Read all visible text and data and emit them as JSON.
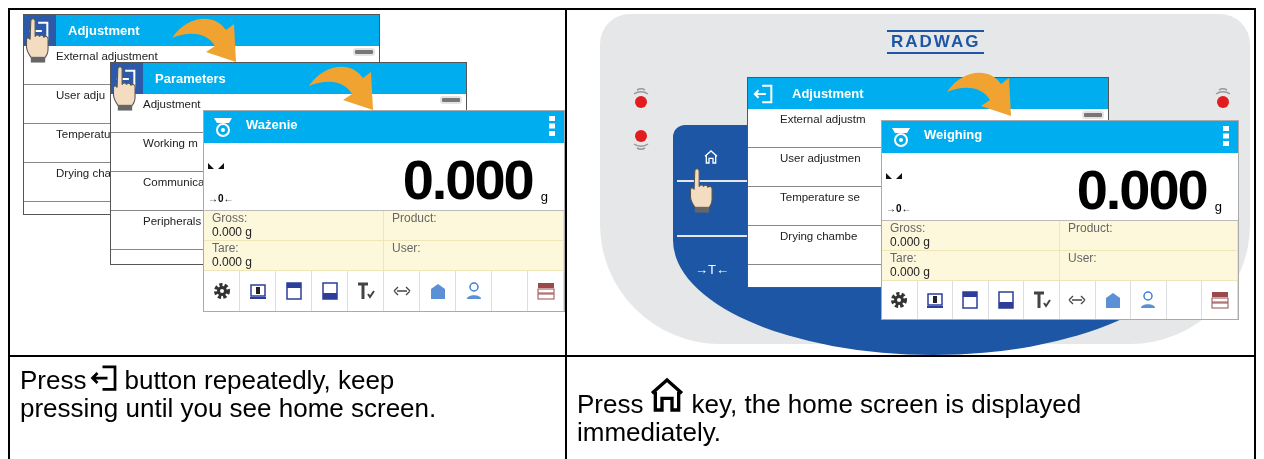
{
  "left_illustration": {
    "screens": [
      {
        "title": "Adjustment",
        "items": [
          "External adjustment",
          "User adju",
          "Temperatu",
          "Drying cha"
        ]
      },
      {
        "title": "Parameters",
        "items": [
          "Adjustment",
          "Working m",
          "Communica",
          "Peripherals"
        ]
      }
    ],
    "weighing": {
      "title": "Ważenie",
      "zero_marker": "→0←",
      "reading": "0.000",
      "unit": "g",
      "fields": [
        {
          "label": "Gross:",
          "value": "0.000 g"
        },
        {
          "label": "Product:"
        },
        {
          "label": "Tare:",
          "value": "0.000 g"
        },
        {
          "label": "User:"
        }
      ]
    }
  },
  "right_illustration": {
    "logo": "RADWAG",
    "tare_key": "→T←",
    "screens": [
      {
        "title": "Adjustment",
        "items": [
          "External adjustm",
          "User adjustmen",
          "Temperature se",
          "Drying chambe"
        ]
      }
    ],
    "weighing": {
      "title": "Weighing",
      "zero_marker": "→0←",
      "reading": "0.000",
      "unit": "g",
      "fields": [
        {
          "label": "Gross:",
          "value": "0.000 g"
        },
        {
          "label": "Product:"
        },
        {
          "label": "Tare:",
          "value": "0.000 g"
        },
        {
          "label": "User:"
        }
      ]
    }
  },
  "captions": [
    {
      "kind": "back",
      "before": "Press",
      "after": "button repeatedly, keep pressing until you see home screen."
    },
    {
      "kind": "home",
      "before": "Press",
      "after": "key, the home screen is displayed immediately."
    }
  ]
}
